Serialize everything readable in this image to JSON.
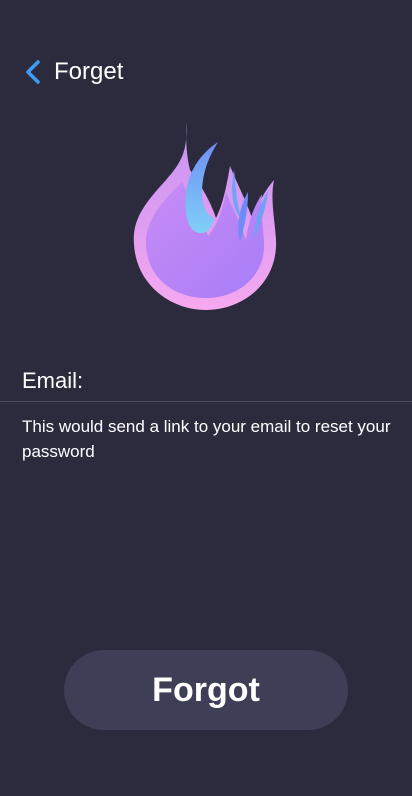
{
  "header": {
    "back_icon": "chevron-left-icon",
    "title": "Forget"
  },
  "logo": {
    "icon": "flame-logo-icon",
    "colors": {
      "outer": "#f09ef2",
      "inner": "#b982f6",
      "accent": "#6ea5f7"
    }
  },
  "form": {
    "email_label": "Email:",
    "email_value": "",
    "help_text": "This would send a link to your email to reset your password"
  },
  "actions": {
    "forgot_label": "Forgot"
  },
  "theme": {
    "background": "#2b2b3d",
    "accent_blue": "#3d9bf2",
    "button_bg": "#3e3f57"
  }
}
